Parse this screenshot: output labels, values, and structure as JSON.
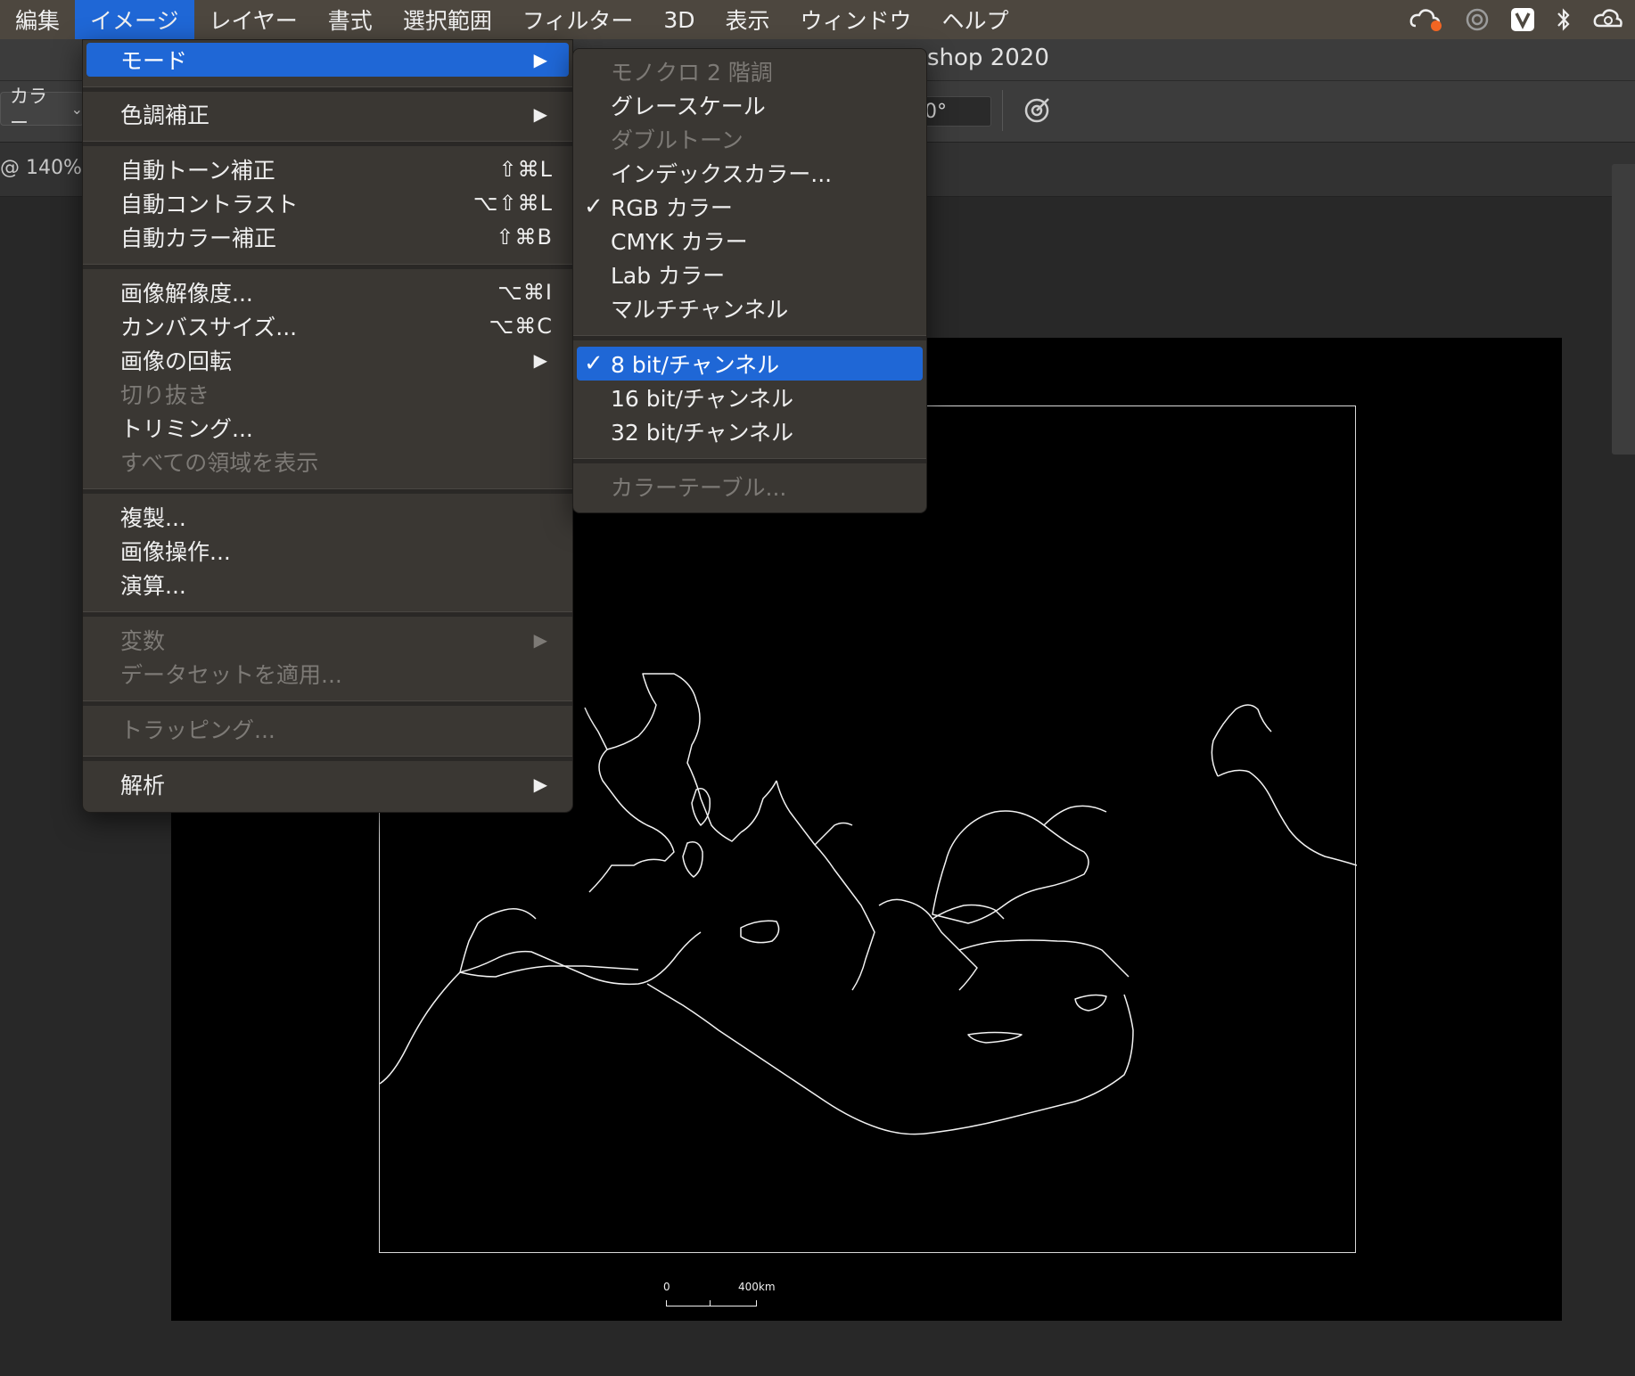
{
  "menubar": {
    "items": [
      "編集",
      "イメージ",
      "レイヤー",
      "書式",
      "選択範囲",
      "フィルター",
      "3D",
      "表示",
      "ウィンドウ",
      "ヘルプ"
    ],
    "active": "イメージ",
    "status_icons": [
      "creative-cloud-icon",
      "sync-icon",
      "vivaldi-icon",
      "bluetooth-icon",
      "cloud-icon"
    ]
  },
  "window": {
    "title_fragment": "shop 2020",
    "zoom_fragment": "@ 140%",
    "color_select": "カラー",
    "angle_value": "0°"
  },
  "menu_image": {
    "items": [
      {
        "label": "モード",
        "shortcut": "",
        "submenu": true,
        "highlighted": true,
        "disabled": false
      },
      {
        "label": "色調補正",
        "shortcut": "",
        "submenu": true,
        "disabled": false
      },
      {
        "label": "自動トーン補正",
        "shortcut": "⇧⌘L",
        "disabled": false
      },
      {
        "label": "自動コントラスト",
        "shortcut": "⌥⇧⌘L",
        "disabled": false
      },
      {
        "label": "自動カラー補正",
        "shortcut": "⇧⌘B",
        "disabled": false
      },
      {
        "label": "画像解像度...",
        "shortcut": "⌥⌘I",
        "disabled": false
      },
      {
        "label": "カンバスサイズ...",
        "shortcut": "⌥⌘C",
        "disabled": false
      },
      {
        "label": "画像の回転",
        "shortcut": "",
        "submenu": true,
        "disabled": false
      },
      {
        "label": "切り抜き",
        "shortcut": "",
        "disabled": true
      },
      {
        "label": "トリミング...",
        "shortcut": "",
        "disabled": false
      },
      {
        "label": "すべての領域を表示",
        "shortcut": "",
        "disabled": true
      },
      {
        "label": "複製...",
        "shortcut": "",
        "disabled": false
      },
      {
        "label": "画像操作...",
        "shortcut": "",
        "disabled": false
      },
      {
        "label": "演算...",
        "shortcut": "",
        "disabled": false
      },
      {
        "label": "変数",
        "shortcut": "",
        "submenu": true,
        "disabled": true
      },
      {
        "label": "データセットを適用...",
        "shortcut": "",
        "disabled": true
      },
      {
        "label": "トラッピング...",
        "shortcut": "",
        "disabled": true
      },
      {
        "label": "解析",
        "shortcut": "",
        "submenu": true,
        "disabled": false
      }
    ]
  },
  "menu_mode": {
    "items": [
      {
        "label": "モノクロ 2 階調",
        "disabled": true,
        "checked": false
      },
      {
        "label": "グレースケール",
        "disabled": false,
        "checked": false
      },
      {
        "label": "ダブルトーン",
        "disabled": true,
        "checked": false
      },
      {
        "label": "インデックスカラー...",
        "disabled": false,
        "checked": false
      },
      {
        "label": "RGB カラー",
        "disabled": false,
        "checked": true
      },
      {
        "label": "CMYK カラー",
        "disabled": false,
        "checked": false
      },
      {
        "label": "Lab カラー",
        "disabled": false,
        "checked": false
      },
      {
        "label": "マルチチャンネル",
        "disabled": false,
        "checked": false
      },
      {
        "label": "8 bit/チャンネル",
        "disabled": false,
        "checked": true,
        "highlighted": true
      },
      {
        "label": "16 bit/チャンネル",
        "disabled": false,
        "checked": false
      },
      {
        "label": "32 bit/チャンネル",
        "disabled": false,
        "checked": false
      },
      {
        "label": "カラーテーブル...",
        "disabled": true,
        "checked": false
      }
    ]
  },
  "map": {
    "scale_zero": "0",
    "scale_max": "400km"
  },
  "symbols": {
    "check": "✓",
    "submenu_arrow": "▶",
    "dropdown_caret": "⌄"
  },
  "colors": {
    "menubar_bg": "#4d473f",
    "highlight": "#1f67d6",
    "menu_bg": "#3a3733"
  }
}
